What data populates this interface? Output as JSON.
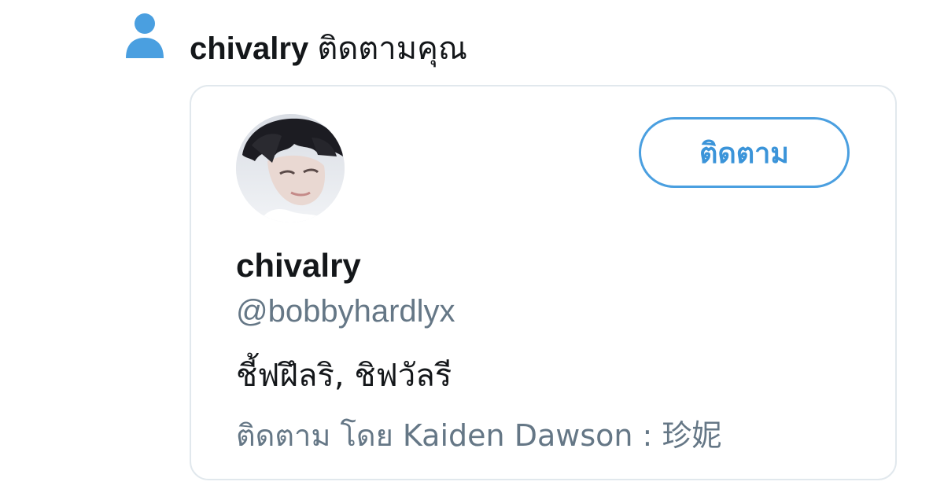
{
  "notification": {
    "icon": "person-icon",
    "username": "chivalry",
    "action_text": "ติดตามคุณ",
    "accent_color": "#4a9fe0"
  },
  "profile_card": {
    "avatar": "profile-photo",
    "follow_button_label": "ติดตาม",
    "display_name": "chivalry",
    "handle": "@bobbyhardlyx",
    "bio": "ชี้ฟฝึลริ, ชิฟวัลรี",
    "followed_by": "ติดตาม โดย Kaiden Dawson : 珍妮"
  }
}
